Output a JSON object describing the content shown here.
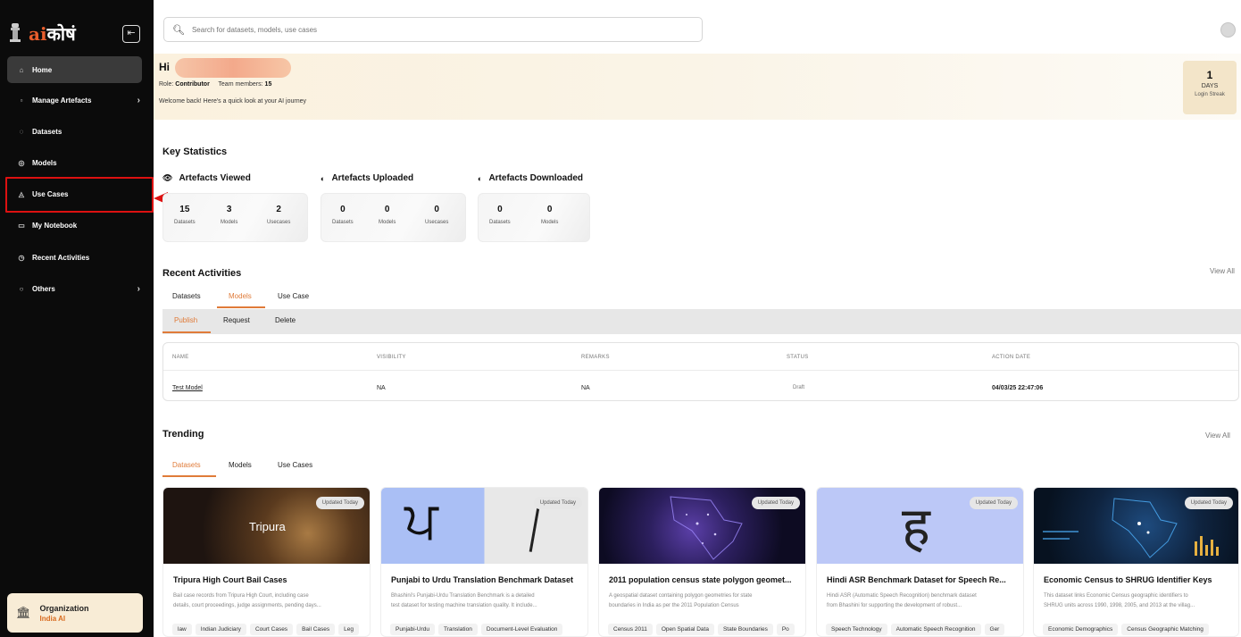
{
  "app": {
    "brand_prefix": "ai",
    "brand_suffix": "कोषं"
  },
  "sidebar": {
    "items": [
      {
        "label": "Home",
        "icon": "home-icon"
      },
      {
        "label": "Manage Artefacts",
        "icon": "folder-icon"
      },
      {
        "label": "Datasets",
        "icon": "database-icon"
      },
      {
        "label": "Models",
        "icon": "cube-icon"
      },
      {
        "label": "Use Cases",
        "icon": "lightbulb-icon"
      },
      {
        "label": "My Notebook",
        "icon": "notebook-icon"
      },
      {
        "label": "Recent Activities",
        "icon": "clock-icon"
      },
      {
        "label": "Others",
        "icon": "more-icon"
      }
    ],
    "org": {
      "title": "Organization",
      "name": "India AI"
    }
  },
  "search": {
    "placeholder": "Search for datasets, models, use cases"
  },
  "welcome": {
    "greeting": "Hi",
    "role_label": "Role:",
    "role": "Contributor",
    "team_label": "Team members:",
    "team_count": "15",
    "message": "Welcome back! Here's a quick look at your AI journey",
    "streak_value": "1",
    "streak_unit": "DAYS",
    "streak_label": "Login Streak"
  },
  "stats": {
    "title": "Key Statistics",
    "viewed": {
      "title": "Artefacts Viewed",
      "items": [
        {
          "v": "15",
          "l": "Datasets"
        },
        {
          "v": "3",
          "l": "Models"
        },
        {
          "v": "2",
          "l": "Usecases"
        }
      ]
    },
    "uploaded": {
      "title": "Artefacts Uploaded",
      "items": [
        {
          "v": "0",
          "l": "Datasets"
        },
        {
          "v": "0",
          "l": "Models"
        },
        {
          "v": "0",
          "l": "Usecases"
        }
      ]
    },
    "downloaded": {
      "title": "Artefacts Downloaded",
      "items": [
        {
          "v": "0",
          "l": "Datasets"
        },
        {
          "v": "0",
          "l": "Models"
        }
      ]
    }
  },
  "recent": {
    "title": "Recent Activities",
    "view_all": "View All",
    "tabs": [
      "Datasets",
      "Models",
      "Use Case"
    ],
    "subtabs": [
      "Publish",
      "Request",
      "Delete"
    ],
    "columns": [
      "NAME",
      "VISIBILITY",
      "REMARKS",
      "STATUS",
      "ACTION DATE"
    ],
    "row": {
      "name": "Test Model",
      "visibility": "NA",
      "remarks": "NA",
      "status": "Draft",
      "date": "04/03/25 22:47:06"
    }
  },
  "trending": {
    "title": "Trending",
    "view_all": "View All",
    "tabs": [
      "Datasets",
      "Models",
      "Use Cases"
    ],
    "badge": "Updated Today",
    "cards": [
      {
        "title": "Tripura High Court Bail Cases",
        "desc1": "Bail case records from Tripura High Court, including case",
        "desc2": "details, court proceedings, judge assignments, pending days...",
        "image_text": "Tripura",
        "tags": [
          "law",
          "Indian Judiciary",
          "Court Cases",
          "Bail Cases",
          "Leg"
        ]
      },
      {
        "title": "Punjabi to Urdu Translation Benchmark Dataset",
        "desc1": "Bhashini's Punjabi-Urdu Translation Benchmark is a detailed",
        "desc2": "test dataset for testing machine translation quality. It include...",
        "image_text": "ਪ",
        "tags": [
          "Punjabi-Urdu",
          "Translation",
          "Document-Level Evaluation"
        ]
      },
      {
        "title": "2011 population census state polygon geomet...",
        "desc1": "A geospatial dataset containing polygon geometries for state",
        "desc2": "boundaries in India as per the 2011 Population Census",
        "image_text": "",
        "tags": [
          "Census 2011",
          "Open Spatial Data",
          "State Boundaries",
          "Po"
        ]
      },
      {
        "title": "Hindi ASR Benchmark Dataset for Speech Re...",
        "desc1": "Hindi ASR (Automatic Speech Recognition) benchmark dataset",
        "desc2": "from Bhashini for supporting the development of robust...",
        "image_text": "ह",
        "tags": [
          "Speech Technology",
          "Automatic Speech Recognition",
          "Ger"
        ]
      },
      {
        "title": "Economic Census to SHRUG Identifier Keys",
        "desc1": "This dataset links Economic Census geographic identifiers to",
        "desc2": "SHRUG units across 1990, 1998, 2005, and 2013 at the villag...",
        "image_text": "",
        "tags": [
          "Economic Demographics",
          "Census Geographic Matching"
        ]
      }
    ]
  },
  "colors": {
    "accent": "#e07b39",
    "sidebar_bg": "#0b0b0b",
    "highlight": "#dd1111"
  }
}
